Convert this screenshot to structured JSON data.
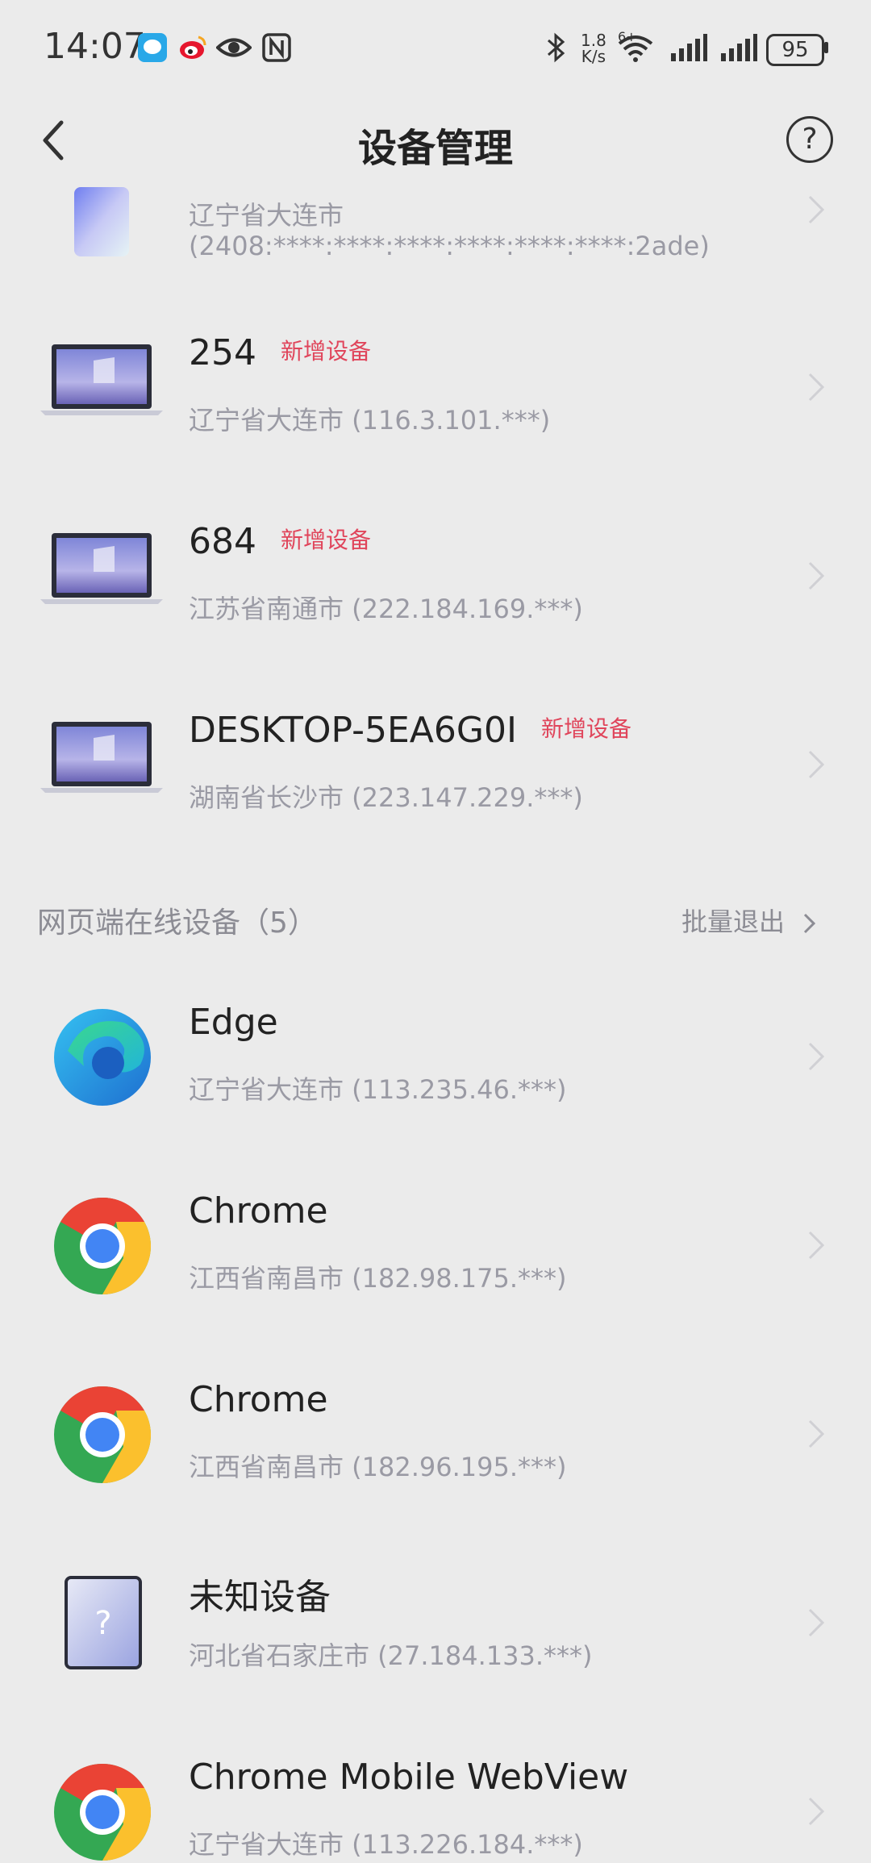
{
  "status_bar": {
    "time": "14:07",
    "net_speed_top": "1.8",
    "net_speed_bottom": "K/s",
    "wifi_tag": "6+",
    "battery": "95"
  },
  "header": {
    "title": "设备管理",
    "help_symbol": "?"
  },
  "partial_device": {
    "location_line1": "辽宁省大连市",
    "location_line2": "(2408:****:****:****:****:****:****:2ade)"
  },
  "app_devices": [
    {
      "name": "254",
      "badge": "新增设备",
      "location": "辽宁省大连市 (116.3.101.***)"
    },
    {
      "name": "684",
      "badge": "新增设备",
      "location": "江苏省南通市 (222.184.169.***)"
    },
    {
      "name": "DESKTOP-5EA6G0I",
      "badge": "新增设备",
      "location": "湖南省长沙市 (223.147.229.***)"
    }
  ],
  "web_section": {
    "title": "网页端在线设备（5）",
    "batch_logout": "批量退出"
  },
  "web_devices": [
    {
      "name": "Edge",
      "location": "辽宁省大连市 (113.235.46.***)"
    },
    {
      "name": "Chrome",
      "location": "江西省南昌市 (182.98.175.***)"
    },
    {
      "name": "Chrome",
      "location": "江西省南昌市 (182.96.195.***)"
    },
    {
      "name": "未知设备",
      "location": "河北省石家庄市 (27.184.133.***)"
    },
    {
      "name": "Chrome Mobile WebView",
      "location": "辽宁省大连市 (113.226.184.***)"
    }
  ],
  "colors": {
    "background": "#ebebeb",
    "badge": "#e0455b",
    "secondary_text": "#9a9aa4"
  }
}
